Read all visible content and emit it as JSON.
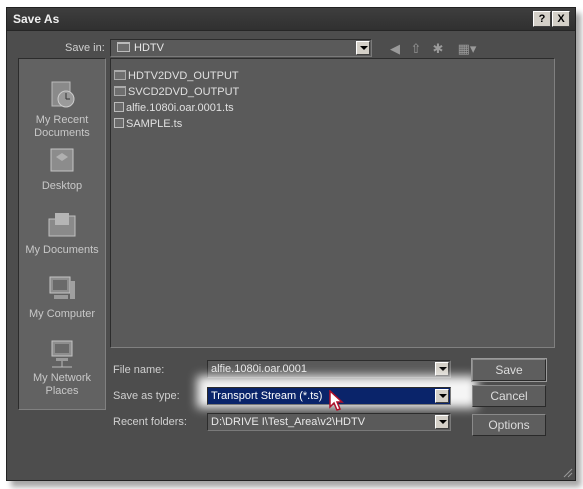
{
  "dialog": {
    "title": "Save As",
    "help_label": "?",
    "close_label": "X"
  },
  "toolbar": {
    "save_in_label": "Save in:",
    "save_in_value": "HDTV",
    "icons": [
      "back-icon",
      "up-folder-icon",
      "new-folder-icon",
      "view-menu-icon"
    ]
  },
  "places": [
    {
      "label": "My Recent Documents",
      "icon": "recent-documents-icon"
    },
    {
      "label": "Desktop",
      "icon": "desktop-icon"
    },
    {
      "label": "My Documents",
      "icon": "my-documents-icon"
    },
    {
      "label": "My Computer",
      "icon": "my-computer-icon"
    },
    {
      "label": "My Network Places",
      "icon": "network-places-icon"
    }
  ],
  "files": [
    {
      "name": "HDTV2DVD_OUTPUT",
      "type": "folder"
    },
    {
      "name": "SVCD2DVD_OUTPUT",
      "type": "folder"
    },
    {
      "name": "alfie.1080i.oar.0001.ts",
      "type": "file"
    },
    {
      "name": "SAMPLE.ts",
      "type": "file"
    }
  ],
  "form": {
    "file_name_label": "File name:",
    "file_name_value": "alfie.1080i.oar.0001",
    "save_type_label": "Save as type:",
    "save_type_value": "Transport Stream (*.ts)",
    "recent_label": "Recent folders:",
    "recent_value": "D:\\DRIVE I\\Test_Area\\v2\\HDTV"
  },
  "buttons": {
    "save": "Save",
    "cancel": "Cancel",
    "options": "Options"
  }
}
